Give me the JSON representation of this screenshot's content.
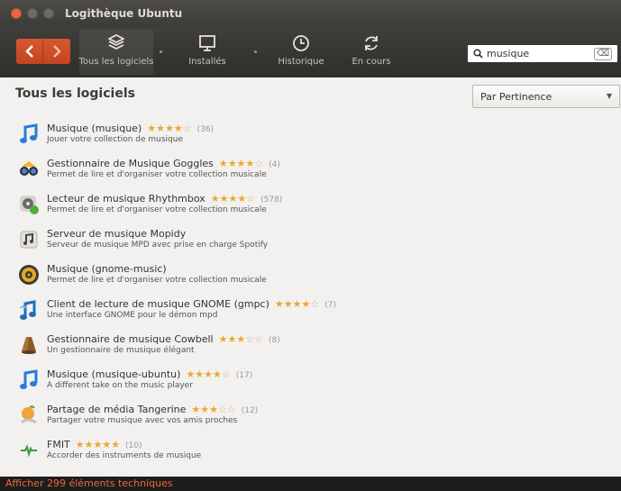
{
  "window": {
    "title": "Logithèque Ubuntu"
  },
  "toolbar": {
    "tabs": [
      {
        "label": "Tous les logiciels",
        "icon": "all-software-icon"
      },
      {
        "label": "Installés",
        "icon": "installed-icon"
      },
      {
        "label": "Historique",
        "icon": "history-icon"
      },
      {
        "label": "En cours",
        "icon": "progress-icon"
      }
    ],
    "search": {
      "value": "musique",
      "clear_label": "⌫"
    }
  },
  "content": {
    "heading": "Tous les logiciels",
    "sort": {
      "selected": "Par Pertinence"
    }
  },
  "apps": [
    {
      "name": "Musique (musique)",
      "stars": 4,
      "count": "(36)",
      "desc": "Jouer votre collection de musique",
      "icon": "music-note-icon"
    },
    {
      "name": "Gestionnaire de Musique Goggles",
      "stars": 4,
      "count": "(4)",
      "desc": "Permet de lire et d'organiser votre collection musicale",
      "icon": "goggles-icon"
    },
    {
      "name": "Lecteur de musique Rhythmbox",
      "stars": 4,
      "count": "(578)",
      "desc": "Permet de lire et d'organiser votre collection musicale",
      "icon": "rhythmbox-icon"
    },
    {
      "name": "Serveur de musique Mopidy",
      "stars": 0,
      "count": "",
      "desc": "Serveur de musique MPD avec prise en charge Spotify",
      "icon": "mopidy-icon"
    },
    {
      "name": "Musique (gnome-music)",
      "stars": 0,
      "count": "",
      "desc": "Permet de lire et d'organiser votre collection musicale",
      "icon": "speaker-icon"
    },
    {
      "name": "Client de lecture de musique GNOME (gmpc)",
      "stars": 4,
      "count": "(7)",
      "desc": "Une interface GNOME pour le démon mpd",
      "icon": "gmpc-icon"
    },
    {
      "name": "Gestionnaire de musique Cowbell",
      "stars": 3,
      "count": "(8)",
      "desc": "Un gestionnaire de musique élégant",
      "icon": "cowbell-icon"
    },
    {
      "name": "Musique (musique-ubuntu)",
      "stars": 4,
      "count": "(17)",
      "desc": "A different take on the music player",
      "icon": "music-note-icon"
    },
    {
      "name": "Partage de média Tangerine",
      "stars": 3,
      "count": "(12)",
      "desc": "Partager votre musique avec vos amis proches",
      "icon": "tangerine-icon"
    },
    {
      "name": "FMIT",
      "stars": 5,
      "count": "(10)",
      "desc": "Accorder des instruments de musique",
      "icon": "fmit-icon"
    }
  ],
  "footer": {
    "label": "Afficher 299 éléments techniques"
  },
  "colors": {
    "accent": "#e9673f",
    "star": "#f0a52b",
    "toolbar": "#3c3b37"
  }
}
